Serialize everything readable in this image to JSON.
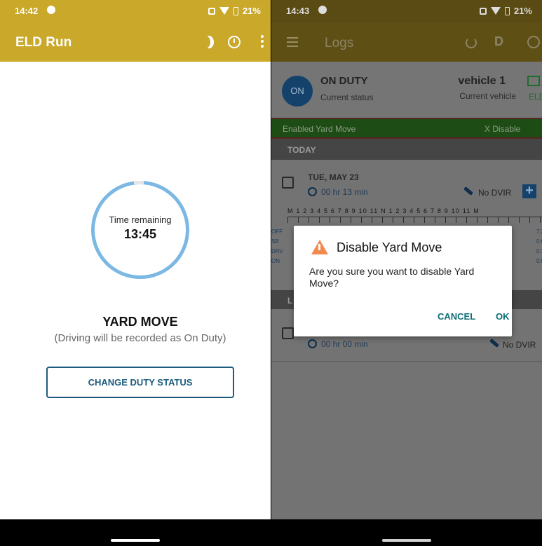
{
  "left": {
    "status_bar": {
      "time": "14:42",
      "battery": "21%"
    },
    "app_bar": {
      "title": "ELD Run"
    },
    "timer": {
      "label": "Time remaining",
      "value": "13:45"
    },
    "yard_move": {
      "title": "YARD MOVE",
      "subtitle": "(Driving will be recorded as On Duty)"
    },
    "change_button": "CHANGE DUTY STATUS"
  },
  "right": {
    "status_bar": {
      "time": "14:43",
      "battery": "21%"
    },
    "app_bar": {
      "title": "Logs",
      "d_label": "D"
    },
    "status_card": {
      "badge": "ON",
      "duty": "ON DUTY",
      "duty_sub": "Current status",
      "vehicle": "vehicle 1",
      "vehicle_sub": "Current vehicle",
      "eld": "ELD"
    },
    "banner": {
      "left": "Enabled Yard Move",
      "right": "X Disable"
    },
    "section_today": "TODAY",
    "section_next": "L",
    "day": {
      "date": "TUE, MAY 23",
      "duration": "00 hr  13 min",
      "dvir": "No DVIR",
      "hours": "M 1 2 3 4 5 6 7 8 9 10 11 N 1 2 3 4 5 6 7 8 9 10 11 M",
      "rows": [
        {
          "label": "OFF",
          "total": "7:3"
        },
        {
          "label": "SB",
          "total": "0:0"
        },
        {
          "label": "DRV",
          "total": "0:1"
        },
        {
          "label": "ON",
          "total": "0:0"
        }
      ]
    },
    "day2": {
      "duration": "00 hr  00 min",
      "dvir": "No DVIR"
    },
    "dialog": {
      "title": "Disable Yard Move",
      "message": "Are you sure you want to disable Yard Move?",
      "cancel": "CANCEL",
      "ok": "OK"
    }
  }
}
